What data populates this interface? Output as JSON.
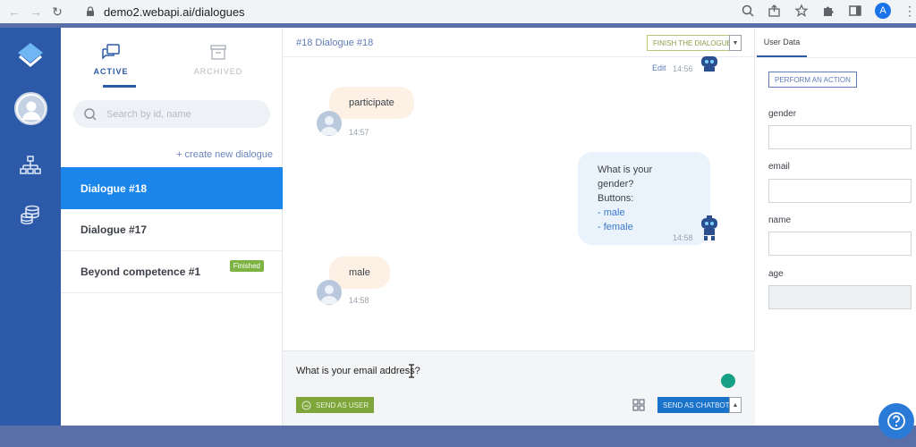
{
  "browser": {
    "url": "demo2.webapi.ai/dialogues",
    "profile_initial": "A"
  },
  "sidebar_tabs": {
    "active": "ACTIVE",
    "archived": "ARCHIVED"
  },
  "search": {
    "placeholder": "Search by id, name"
  },
  "create_link": "+ create new dialogue",
  "dialogues": [
    {
      "name": "Dialogue #18",
      "selected": true,
      "badge": ""
    },
    {
      "name": "Dialogue #17",
      "selected": false,
      "badge": ""
    },
    {
      "name": "Beyond competence #1",
      "selected": false,
      "badge": "Finished"
    }
  ],
  "chat": {
    "title": "#18 Dialogue #18",
    "finish_label": "FINISH THE DIALOGUE",
    "edit_label": "Edit",
    "messages": [
      {
        "from": "bot",
        "time": "14:56"
      },
      {
        "from": "user",
        "text": "participate",
        "time": "14:57"
      },
      {
        "from": "bot",
        "title": "What is your gender?",
        "buttons_label": "Buttons:",
        "buttons": [
          "- male",
          "- female"
        ],
        "time": "14:58"
      },
      {
        "from": "user",
        "text": "male",
        "time": "14:58"
      }
    ],
    "draft": "What is your email address?",
    "send_user_label": "SEND AS USER",
    "send_bot_label": "SEND AS CHATBOT"
  },
  "user_data": {
    "tab_label": "User Data",
    "action_label": "PERFORM AN ACTION",
    "fields": [
      {
        "label": "gender",
        "value": ""
      },
      {
        "label": "email",
        "value": ""
      },
      {
        "label": "name",
        "value": ""
      },
      {
        "label": "age",
        "value": ""
      }
    ]
  },
  "colors": {
    "rail": "#2d5aa8",
    "selected_item": "#1a86ec",
    "finished_badge": "#7cb342",
    "send_user": "#7ea63a",
    "send_bot": "#1a73c8"
  },
  "icons": [
    "back-arrow-icon",
    "forward-arrow-icon",
    "reload-icon",
    "lock-icon",
    "zoom-icon",
    "share-icon",
    "star-icon",
    "puzzle-icon",
    "sidebar-icon",
    "logo-icon",
    "user-avatar-icon",
    "org-tree-icon",
    "coins-icon",
    "chat-bubbles-icon",
    "archive-box-icon",
    "search-icon",
    "robot-icon",
    "text-cursor-icon",
    "spinner-icon",
    "grid-icon",
    "help-icon"
  ]
}
